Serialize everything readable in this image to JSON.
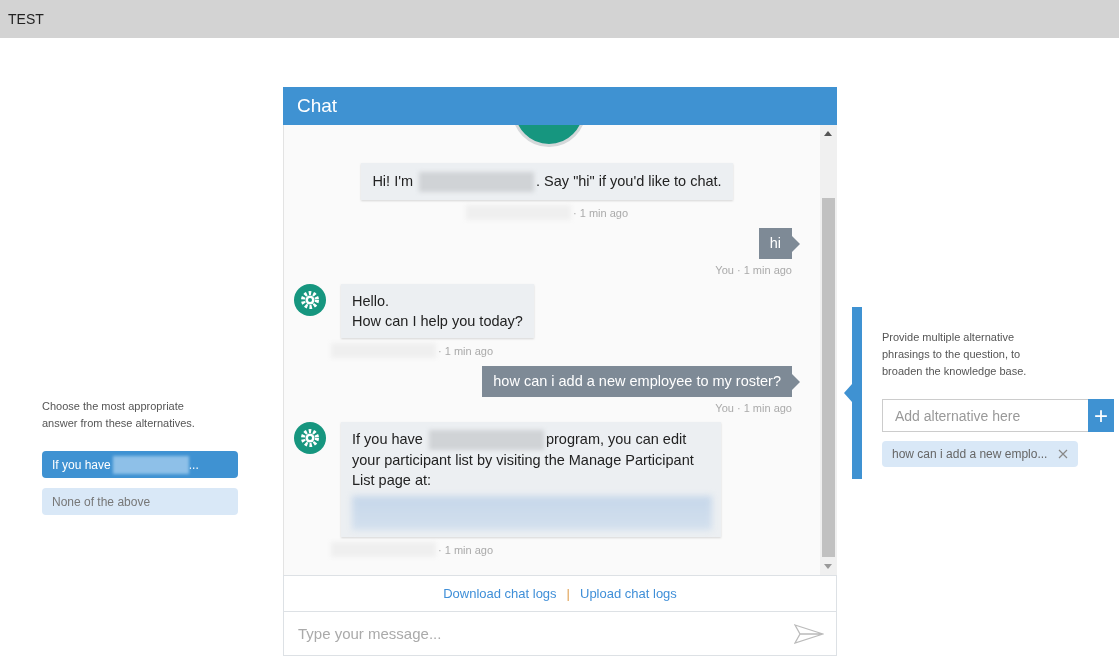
{
  "window": {
    "title": "TEST"
  },
  "left_panel": {
    "instruction": "Choose the most appropriate answer from these alternatives.",
    "options": [
      {
        "kind": "redacted",
        "text": "If you have",
        "suffix": "...",
        "selected": true
      },
      {
        "kind": "plain",
        "text": "None of the above",
        "selected": false
      }
    ]
  },
  "chat": {
    "title": "Chat",
    "messages": [
      {
        "kind": "intro",
        "parts": [
          {
            "kind": "text",
            "text": "Hi! I'm"
          },
          {
            "kind": "redacted"
          },
          {
            "kind": "text",
            "text": ". Say \"hi\" if you'd like to chat."
          }
        ],
        "meta": "· 1 min ago",
        "meta_redacted": true
      },
      {
        "kind": "user",
        "parts": [
          {
            "kind": "text",
            "text": "hi"
          }
        ],
        "meta": "You · 1 min ago",
        "meta_redacted": false
      },
      {
        "kind": "bot",
        "parts": [
          {
            "kind": "text",
            "text": "Hello."
          },
          {
            "kind": "break"
          },
          {
            "kind": "text",
            "text": "How can I help you today?"
          }
        ],
        "meta": "· 1 min ago",
        "meta_redacted": true
      },
      {
        "kind": "user",
        "parts": [
          {
            "kind": "text",
            "text": "how can i add a new employee to my roster?"
          }
        ],
        "meta": "You · 1 min ago",
        "meta_redacted": false
      },
      {
        "kind": "bot",
        "parts": [
          {
            "kind": "text",
            "text": "If you have"
          },
          {
            "kind": "redacted"
          },
          {
            "kind": "text",
            "text": "program, you can edit your participant list by visiting the Manage Participant List page at:"
          },
          {
            "kind": "redacted-link"
          }
        ],
        "meta": "· 1 min ago",
        "meta_redacted": true
      }
    ],
    "links": [
      "Download chat logs",
      "Upload chat logs"
    ],
    "separator": "|",
    "input": {
      "placeholder": "Type your message..."
    }
  },
  "right_panel": {
    "instruction": "Provide multiple alternative phrasings to the question, to broaden the knowledge base.",
    "input": {
      "placeholder": "Add alternative here"
    },
    "add_button": "+",
    "tags": [
      "how can i add a new emplo..."
    ]
  }
}
